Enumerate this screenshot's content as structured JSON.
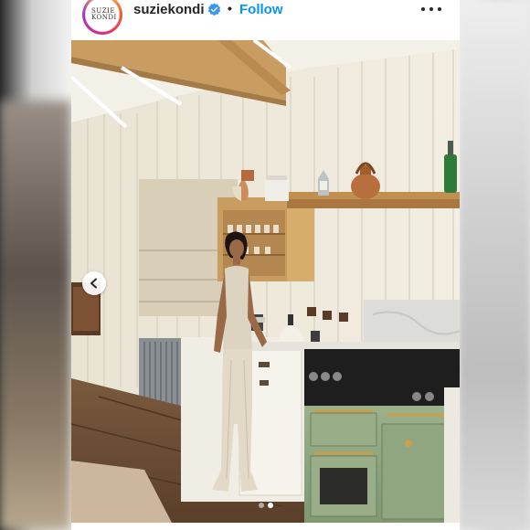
{
  "post": {
    "avatar_text": "SUZIE\nKONDI",
    "username": "suziekondi",
    "separator": "•",
    "follow_label": "Follow"
  },
  "carousel": {
    "total_slides": 2,
    "current_slide": 2
  },
  "colors": {
    "follow_blue": "#0095f6",
    "verified_blue": "#3897f0",
    "text_dark": "#262626"
  },
  "icons": {
    "verified": "verified-badge-icon",
    "more": "more-options-icon",
    "prev": "chevron-left-icon"
  }
}
